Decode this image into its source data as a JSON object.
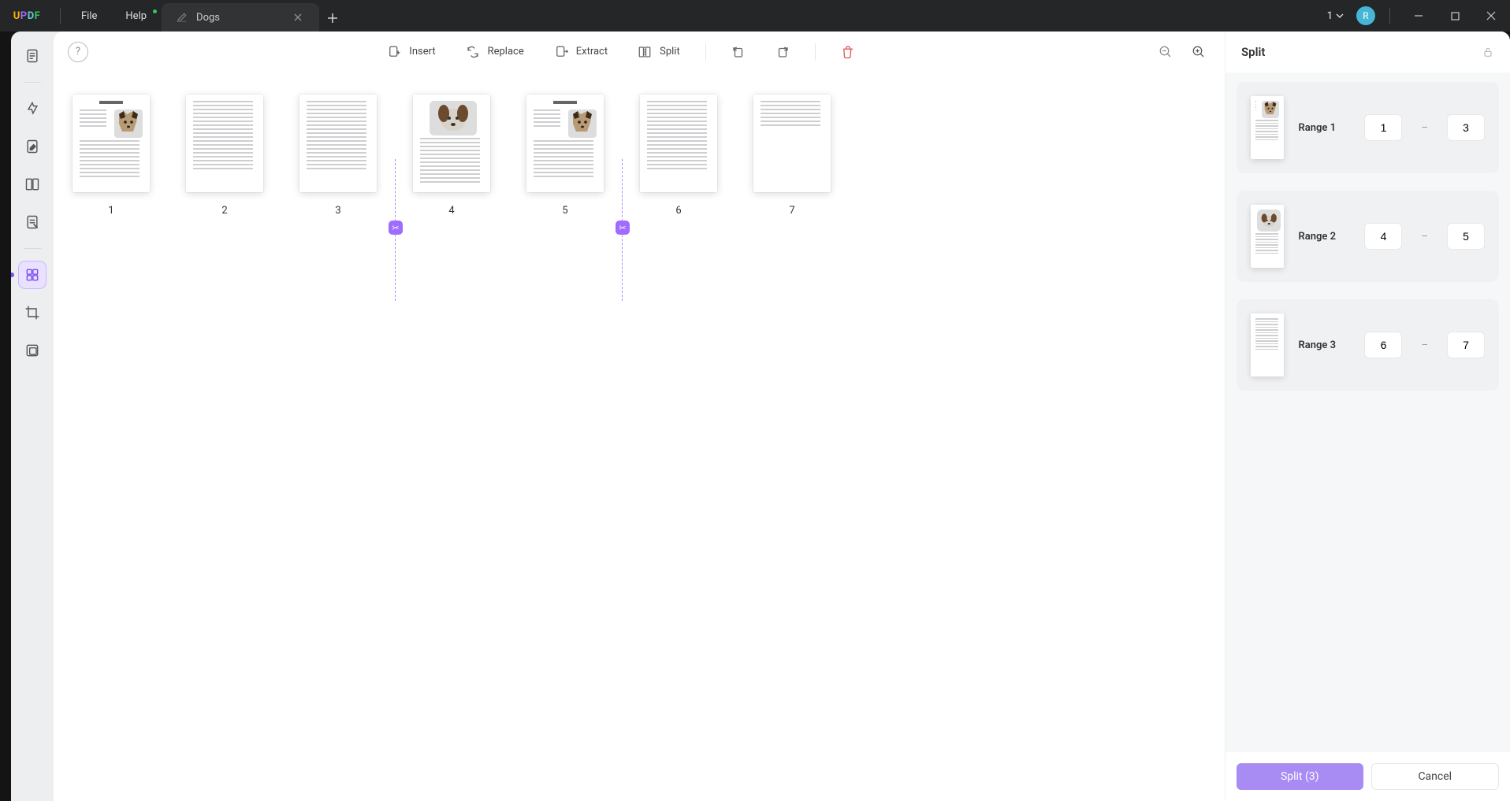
{
  "app": {
    "logo_letters": [
      "U",
      "P",
      "D",
      "F"
    ],
    "menus": {
      "file": "File",
      "help": "Help"
    },
    "tab": {
      "title": "Dogs"
    },
    "account": {
      "count": "1",
      "initial": "R"
    }
  },
  "toolbar": {
    "insert": "Insert",
    "replace": "Replace",
    "extract": "Extract",
    "split": "Split"
  },
  "pages": [
    {
      "num": "1",
      "kind": "dog-right"
    },
    {
      "num": "2",
      "kind": "text"
    },
    {
      "num": "3",
      "kind": "text"
    },
    {
      "num": "4",
      "kind": "dog-top"
    },
    {
      "num": "5",
      "kind": "dog-right"
    },
    {
      "num": "6",
      "kind": "text"
    },
    {
      "num": "7",
      "kind": "text-short"
    }
  ],
  "split_marks": [
    3,
    5
  ],
  "right_panel": {
    "title": "Split",
    "ranges": [
      {
        "label": "Range 1",
        "from": "1",
        "to": "3",
        "thumb": "dog-right"
      },
      {
        "label": "Range 2",
        "from": "4",
        "to": "5",
        "thumb": "dog-top"
      },
      {
        "label": "Range 3",
        "from": "6",
        "to": "7",
        "thumb": "text"
      }
    ],
    "split_btn": "Split (3)",
    "cancel_btn": "Cancel"
  }
}
